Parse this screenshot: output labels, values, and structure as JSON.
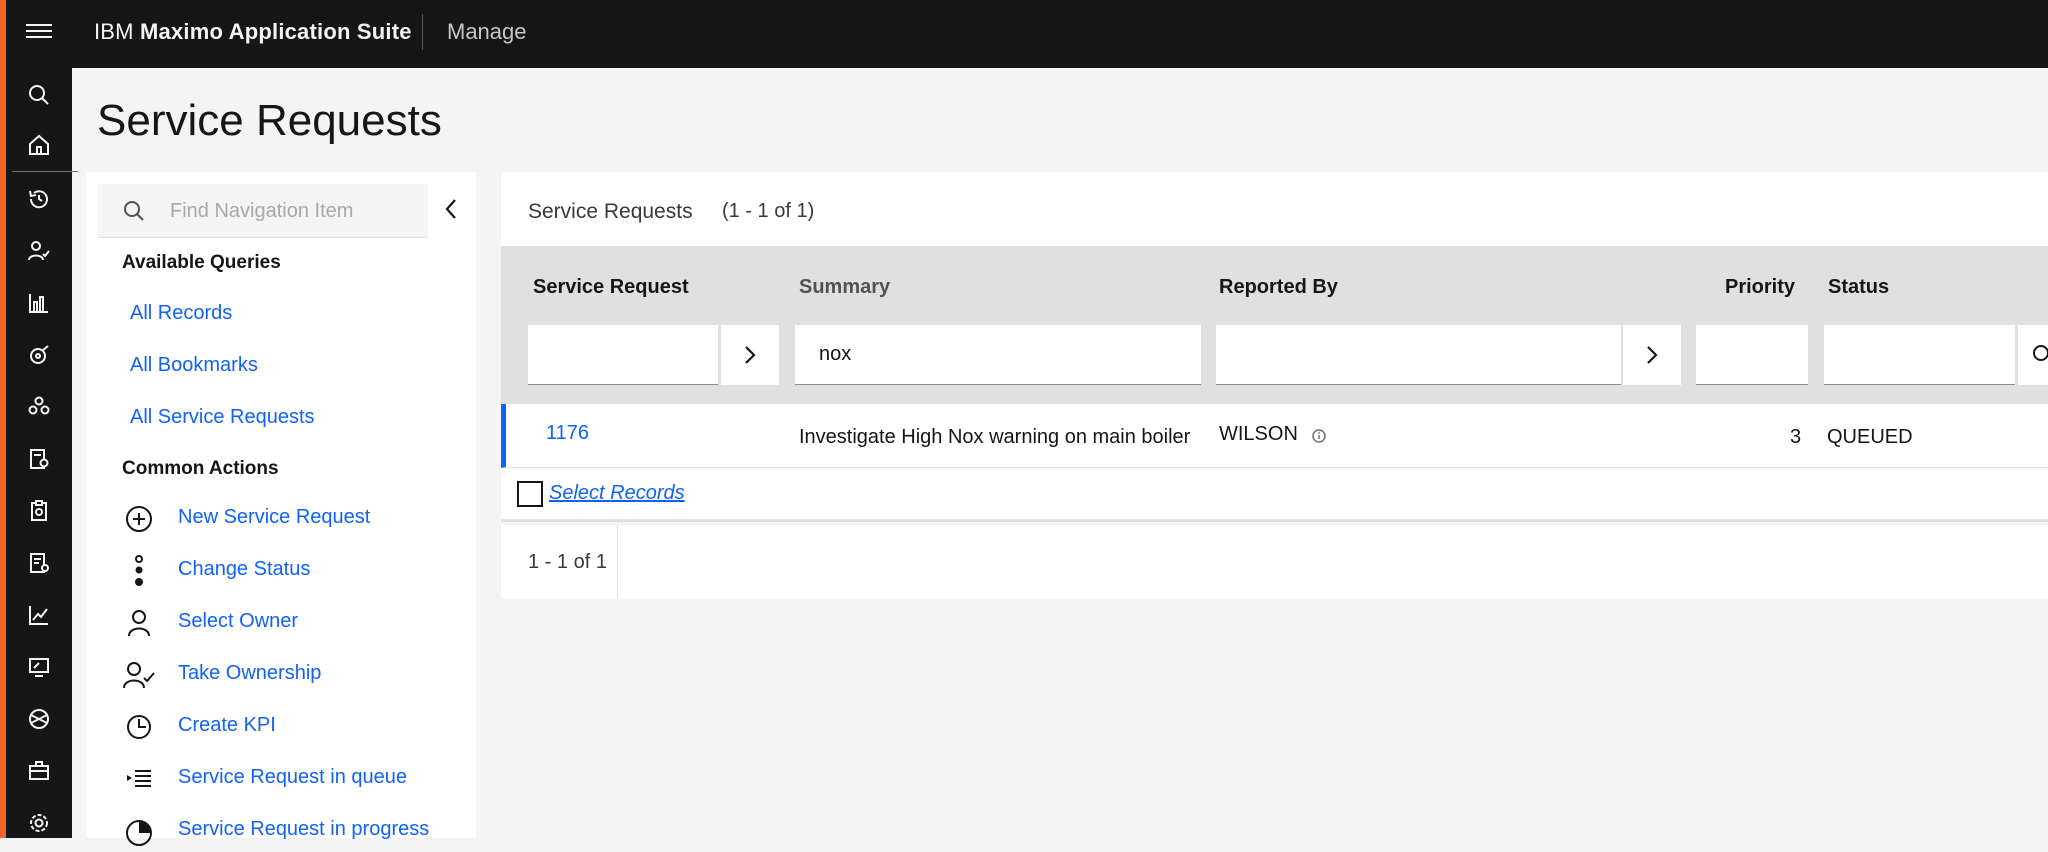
{
  "header": {
    "brand_prefix": "IBM",
    "brand_name": "Maximo Application Suite",
    "app_name": "Manage"
  },
  "rail_icons": [
    "search-icon",
    "home-icon",
    "history-icon",
    "user-check-icon",
    "chart-bar-icon",
    "tools-icon",
    "group-icon",
    "report-icon",
    "clipboard-icon",
    "document-icon",
    "chart-line-icon",
    "screen-icon",
    "hex-icon",
    "briefcase-icon",
    "settings-icon"
  ],
  "page": {
    "title": "Service Requests"
  },
  "sidenav": {
    "search_placeholder": "Find Navigation Item",
    "queries_heading": "Available Queries",
    "queries": [
      "All Records",
      "All Bookmarks",
      "All Service Requests"
    ],
    "actions_heading": "Common Actions",
    "actions": [
      {
        "label": "New Service Request",
        "icon": "add-circle-icon"
      },
      {
        "label": "Change Status",
        "icon": "status-icon"
      },
      {
        "label": "Select Owner",
        "icon": "user-icon"
      },
      {
        "label": "Take Ownership",
        "icon": "user-check-icon"
      },
      {
        "label": "Create KPI",
        "icon": "kpi-clock-icon"
      },
      {
        "label": "Service Request in queue",
        "icon": "queue-list-icon"
      },
      {
        "label": "Service Request in progress",
        "icon": "pie-progress-icon"
      }
    ]
  },
  "table": {
    "title": "Service Requests",
    "count": "(1 - 1 of 1)",
    "columns": [
      "Service Request",
      "Summary",
      "Reported By",
      "Priority",
      "Status"
    ],
    "filters": {
      "service_request": "",
      "summary": "nox",
      "reported_by": "",
      "priority": "",
      "status": ""
    },
    "rows": [
      {
        "service_request": "1176",
        "summary": "Investigate High Nox warning on main boiler",
        "reported_by": "WILSON",
        "priority": "3",
        "status": "QUEUED"
      }
    ],
    "select_records": "Select Records",
    "pager": "1 - 1 of 1"
  },
  "colors": {
    "accent": "#0f62fe",
    "topbar": "#161616",
    "rail_stripe": "#f1652b"
  }
}
